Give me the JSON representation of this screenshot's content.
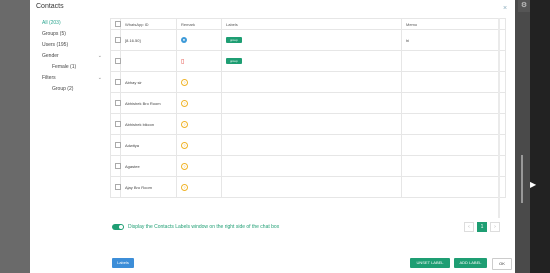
{
  "modal": {
    "title": "Contacts",
    "close_glyph": "×"
  },
  "nav": {
    "all": "All (203)",
    "groups": "Groups (5)",
    "users": "Users (195)",
    "gender": "Gender",
    "female": "Female (1)",
    "filters": "Filters",
    "group": "Group (2)",
    "chevron": "⌄"
  },
  "table": {
    "headers": [
      "WhatsApp ID",
      "Remark",
      "Labels",
      "Memo"
    ],
    "rows": [
      {
        "wa_id": "[8.16.50]",
        "remark_icon": "info-icon",
        "label": "group",
        "memo": "hi"
      },
      {
        "wa_id": "",
        "remark_icon": "trash-icon",
        "label": "group",
        "memo": ""
      },
      {
        "wa_id": "Abhay sir",
        "remark_icon": "question-icon",
        "label": "",
        "memo": ""
      },
      {
        "wa_id": "Abhishek Bro Room",
        "remark_icon": "question-icon",
        "label": "",
        "memo": ""
      },
      {
        "wa_id": "Abhishek bikcon",
        "remark_icon": "question-icon",
        "label": "",
        "memo": ""
      },
      {
        "wa_id": "Adwitya",
        "remark_icon": "question-icon",
        "label": "",
        "memo": ""
      },
      {
        "wa_id": "Agastee",
        "remark_icon": "question-icon",
        "label": "",
        "memo": ""
      },
      {
        "wa_id": "Ajay Bro Room",
        "remark_icon": "question-icon",
        "label": "",
        "memo": ""
      }
    ]
  },
  "toggle": {
    "label": "Display the Contacts Labels window on the right side of the chat box",
    "on": true
  },
  "pager": {
    "prev": "‹",
    "current": "1",
    "next": "›"
  },
  "buttons": {
    "labels": "Labels",
    "unset": "UNSET LABEL",
    "add": "ADD LABEL",
    "ok": "OK"
  },
  "icons": {
    "gear": "⚙",
    "info": "●",
    "trash": "🗑",
    "question": "?"
  },
  "colors": {
    "accent": "#1e9e73",
    "blue": "#3d8ed8",
    "warn": "#f0b429",
    "danger": "#e0352d"
  }
}
